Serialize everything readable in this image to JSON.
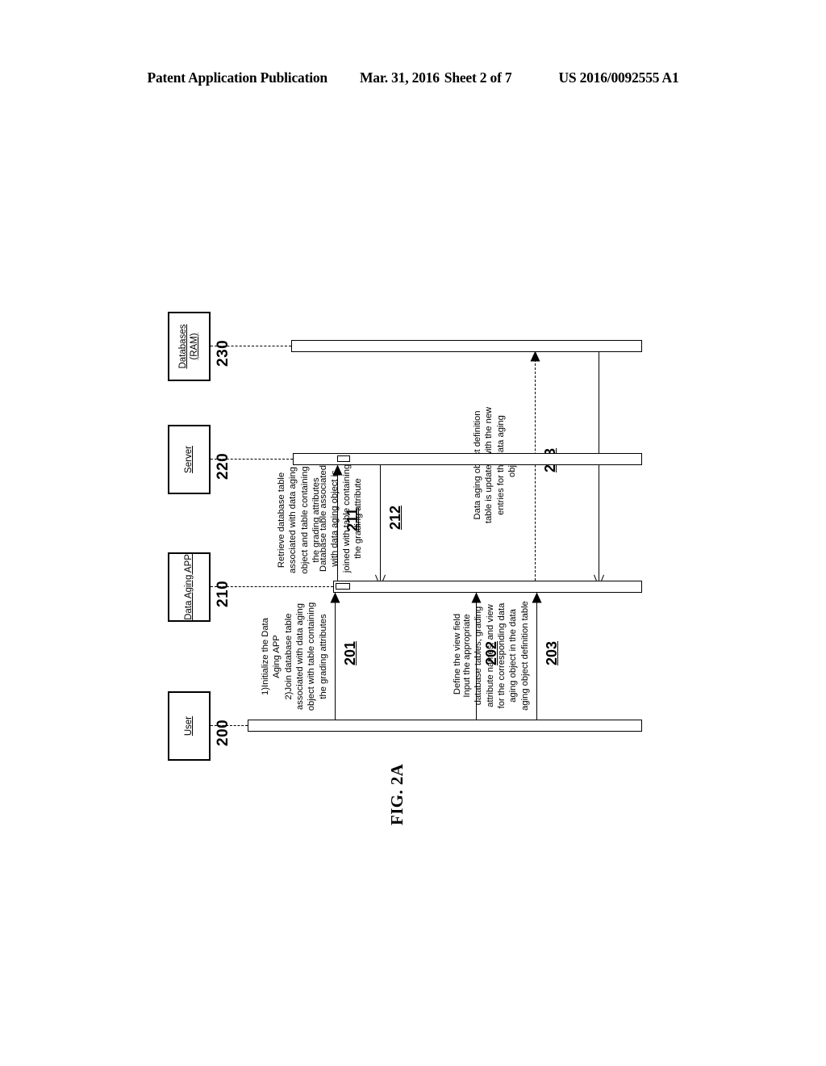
{
  "header": {
    "publication": "Patent Application Publication",
    "date": "Mar. 31, 2016",
    "sheet": "Sheet 2 of 7",
    "number": "US 2016/0092555 A1"
  },
  "figure": {
    "caption": "FIG. 2A"
  },
  "lifelines": [
    {
      "id": "user",
      "label": "User",
      "ref": "200"
    },
    {
      "id": "app",
      "label": "Data Aging APP",
      "ref": "210"
    },
    {
      "id": "server",
      "label": "Server",
      "ref": "220"
    },
    {
      "id": "databases",
      "label": "Databases\n(RAM)",
      "ref": "230"
    }
  ],
  "messages": [
    {
      "id": "m201",
      "ref": "201",
      "from": "user",
      "to": "app",
      "style": "solid",
      "text": "1)Initialize the Data\nAging APP\n2)Join database table\nassociated with data aging\nobject with table containing\nthe grading attributes"
    },
    {
      "id": "m211",
      "ref": "211",
      "from": "app",
      "to": "server",
      "style": "solid",
      "text": "Retrieve database table\nassociated with data aging\nobject and table containing\nthe grading attributes"
    },
    {
      "id": "m212",
      "ref": "212",
      "from": "server",
      "to": "app",
      "style": "solid-return",
      "text": "Database table associated\nwith data aging object is\njoined with table containing\nthe grading attribute"
    },
    {
      "id": "m202",
      "ref": "202",
      "from": "user",
      "to": "app",
      "style": "solid",
      "text": "Define the view field"
    },
    {
      "id": "m203",
      "ref": "203",
      "from": "user",
      "to": "app",
      "style": "solid",
      "text": "Input the appropriate\ndatabase tables, grading\nattribute names, and view\nfor the corresponding data\naging object in the data\naging object definition table"
    },
    {
      "id": "m213",
      "ref": "213",
      "from": "app",
      "to": "databases",
      "style": "dashed",
      "text": "Data aging object definition\ntable is updated with the new\nentries for the data aging\nobject"
    }
  ],
  "colors": {
    "ink": "#000000",
    "paper": "#ffffff"
  }
}
